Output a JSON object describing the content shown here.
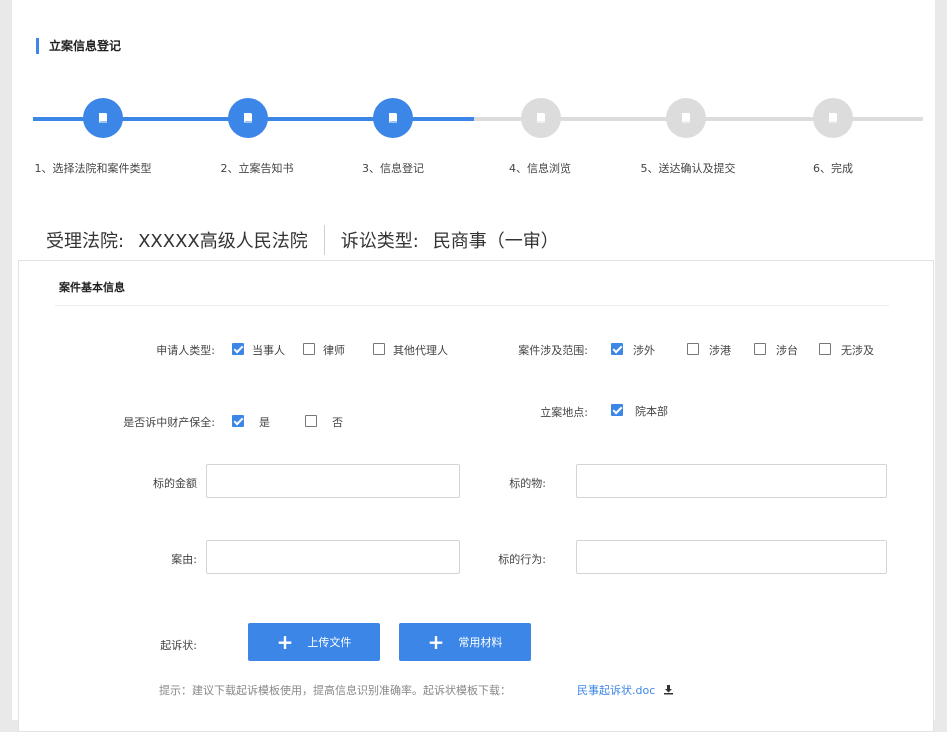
{
  "header": {
    "section_title": "立案信息登记"
  },
  "steps": [
    {
      "label": "1、选择法院和案件类型",
      "active": true
    },
    {
      "label": "2、立案告知书",
      "active": true
    },
    {
      "label": "3、信息登记",
      "active": true
    },
    {
      "label": "4、信息浏览",
      "active": false
    },
    {
      "label": "5、送达确认及提交",
      "active": false
    },
    {
      "label": "6、完成",
      "active": false
    }
  ],
  "court": {
    "court_label": "受理法院:",
    "court_value": "XXXXX高级人民法院",
    "type_label": "诉讼类型:",
    "type_value": "民商事（一审）"
  },
  "form": {
    "title": "案件基本信息",
    "applicant_type": {
      "label": "申请人类型:",
      "options": [
        {
          "label": "当事人",
          "checked": true
        },
        {
          "label": "律师",
          "checked": false
        },
        {
          "label": "其他代理人",
          "checked": false
        }
      ]
    },
    "case_scope": {
      "label": "案件涉及范围:",
      "options": [
        {
          "label": "涉外",
          "checked": true
        },
        {
          "label": "涉港",
          "checked": false
        },
        {
          "label": "涉台",
          "checked": false
        },
        {
          "label": "无涉及",
          "checked": false
        }
      ]
    },
    "property_preservation": {
      "label": "是否诉中财产保全:",
      "options": [
        {
          "label": "是",
          "checked": true
        },
        {
          "label": "否",
          "checked": false
        }
      ]
    },
    "filing_location": {
      "label": "立案地点:",
      "options": [
        {
          "label": "院本部",
          "checked": true
        }
      ]
    },
    "amount": {
      "label": "标的金额",
      "value": "",
      "placeholder": ""
    },
    "subject": {
      "label": "标的物:",
      "value": "",
      "placeholder": ""
    },
    "cause": {
      "label": "案由:",
      "value": "",
      "placeholder": ""
    },
    "subject_action": {
      "label": "标的行为:",
      "value": "",
      "placeholder": ""
    },
    "complaint": {
      "label": "起诉状:",
      "upload_label": "上传文件",
      "common_label": "常用材料"
    },
    "hint": {
      "text": "提示：建议下载起诉模板使用，提高信息识别准确率。起诉状模板下载：",
      "link": "民事起诉状.doc"
    }
  },
  "colors": {
    "accent": "#3c86e8",
    "inactive": "#dcdcdc"
  },
  "icons": {
    "step": "book-icon",
    "upload": "plus-icon",
    "download": "download-icon"
  }
}
